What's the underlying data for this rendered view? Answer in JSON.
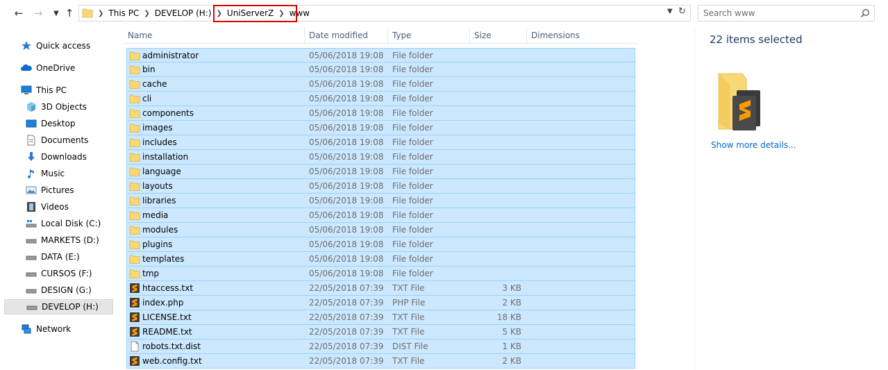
{
  "address": {
    "crumbs": [
      "This PC",
      "DEVELOP (H:)",
      "UniServerZ",
      "www"
    ]
  },
  "search": {
    "placeholder": "Search www"
  },
  "nav": [
    {
      "label": "Quick access",
      "icon": "star-icon",
      "level": "root"
    },
    {
      "label": "OneDrive",
      "icon": "cloud-icon",
      "level": "root"
    },
    {
      "label": "This PC",
      "icon": "computer-icon",
      "level": "root"
    },
    {
      "label": "3D Objects",
      "icon": "cube-icon",
      "level": "sub"
    },
    {
      "label": "Desktop",
      "icon": "desktop-icon",
      "level": "sub"
    },
    {
      "label": "Documents",
      "icon": "document-icon",
      "level": "sub"
    },
    {
      "label": "Downloads",
      "icon": "download-icon",
      "level": "sub"
    },
    {
      "label": "Music",
      "icon": "music-icon",
      "level": "sub"
    },
    {
      "label": "Pictures",
      "icon": "pictures-icon",
      "level": "sub"
    },
    {
      "label": "Videos",
      "icon": "video-icon",
      "level": "sub"
    },
    {
      "label": "Local Disk (C:)",
      "icon": "system-drive-icon",
      "level": "sub"
    },
    {
      "label": "MARKETS (D:)",
      "icon": "drive-icon",
      "level": "sub"
    },
    {
      "label": "DATA (E:)",
      "icon": "drive-icon",
      "level": "sub"
    },
    {
      "label": "CURSOS (F:)",
      "icon": "drive-icon",
      "level": "sub"
    },
    {
      "label": "DESIGN (G:)",
      "icon": "drive-icon",
      "level": "sub"
    },
    {
      "label": "DEVELOP (H:)",
      "icon": "drive-icon",
      "level": "sub",
      "selected": true
    },
    {
      "label": "Network",
      "icon": "network-icon",
      "level": "root"
    }
  ],
  "columns": [
    "Name",
    "Date modified",
    "Type",
    "Size",
    "Dimensions"
  ],
  "files": [
    {
      "name": "administrator",
      "date": "05/06/2018 19:08",
      "type": "File folder",
      "size": "",
      "icon": "folder-icon"
    },
    {
      "name": "bin",
      "date": "05/06/2018 19:08",
      "type": "File folder",
      "size": "",
      "icon": "folder-icon"
    },
    {
      "name": "cache",
      "date": "05/06/2018 19:08",
      "type": "File folder",
      "size": "",
      "icon": "folder-icon"
    },
    {
      "name": "cli",
      "date": "05/06/2018 19:08",
      "type": "File folder",
      "size": "",
      "icon": "folder-icon"
    },
    {
      "name": "components",
      "date": "05/06/2018 19:08",
      "type": "File folder",
      "size": "",
      "icon": "folder-icon"
    },
    {
      "name": "images",
      "date": "05/06/2018 19:08",
      "type": "File folder",
      "size": "",
      "icon": "folder-icon"
    },
    {
      "name": "includes",
      "date": "05/06/2018 19:08",
      "type": "File folder",
      "size": "",
      "icon": "folder-icon"
    },
    {
      "name": "installation",
      "date": "05/06/2018 19:08",
      "type": "File folder",
      "size": "",
      "icon": "folder-icon"
    },
    {
      "name": "language",
      "date": "05/06/2018 19:08",
      "type": "File folder",
      "size": "",
      "icon": "folder-icon"
    },
    {
      "name": "layouts",
      "date": "05/06/2018 19:08",
      "type": "File folder",
      "size": "",
      "icon": "folder-icon"
    },
    {
      "name": "libraries",
      "date": "05/06/2018 19:08",
      "type": "File folder",
      "size": "",
      "icon": "folder-icon"
    },
    {
      "name": "media",
      "date": "05/06/2018 19:08",
      "type": "File folder",
      "size": "",
      "icon": "folder-icon"
    },
    {
      "name": "modules",
      "date": "05/06/2018 19:08",
      "type": "File folder",
      "size": "",
      "icon": "folder-icon"
    },
    {
      "name": "plugins",
      "date": "05/06/2018 19:08",
      "type": "File folder",
      "size": "",
      "icon": "folder-icon"
    },
    {
      "name": "templates",
      "date": "05/06/2018 19:08",
      "type": "File folder",
      "size": "",
      "icon": "folder-icon"
    },
    {
      "name": "tmp",
      "date": "05/06/2018 19:08",
      "type": "File folder",
      "size": "",
      "icon": "folder-icon"
    },
    {
      "name": "htaccess.txt",
      "date": "22/05/2018 07:39",
      "type": "TXT File",
      "size": "3 KB",
      "icon": "sublime-file-icon"
    },
    {
      "name": "index.php",
      "date": "22/05/2018 07:39",
      "type": "PHP File",
      "size": "2 KB",
      "icon": "sublime-file-icon"
    },
    {
      "name": "LICENSE.txt",
      "date": "22/05/2018 07:39",
      "type": "TXT File",
      "size": "18 KB",
      "icon": "sublime-file-icon"
    },
    {
      "name": "README.txt",
      "date": "22/05/2018 07:39",
      "type": "TXT File",
      "size": "5 KB",
      "icon": "sublime-file-icon"
    },
    {
      "name": "robots.txt.dist",
      "date": "22/05/2018 07:39",
      "type": "DIST File",
      "size": "1 KB",
      "icon": "blank-file-icon"
    },
    {
      "name": "web.config.txt",
      "date": "22/05/2018 07:39",
      "type": "TXT File",
      "size": "2 KB",
      "icon": "sublime-file-icon"
    }
  ],
  "details": {
    "selected_count": "22 items selected",
    "more_link": "Show more details..."
  },
  "colors": {
    "selection_bg": "#cce8ff",
    "selection_border": "#99d1ff",
    "highlight_box": "#e00000",
    "folder": "#f8d775",
    "link": "#0066cc"
  }
}
